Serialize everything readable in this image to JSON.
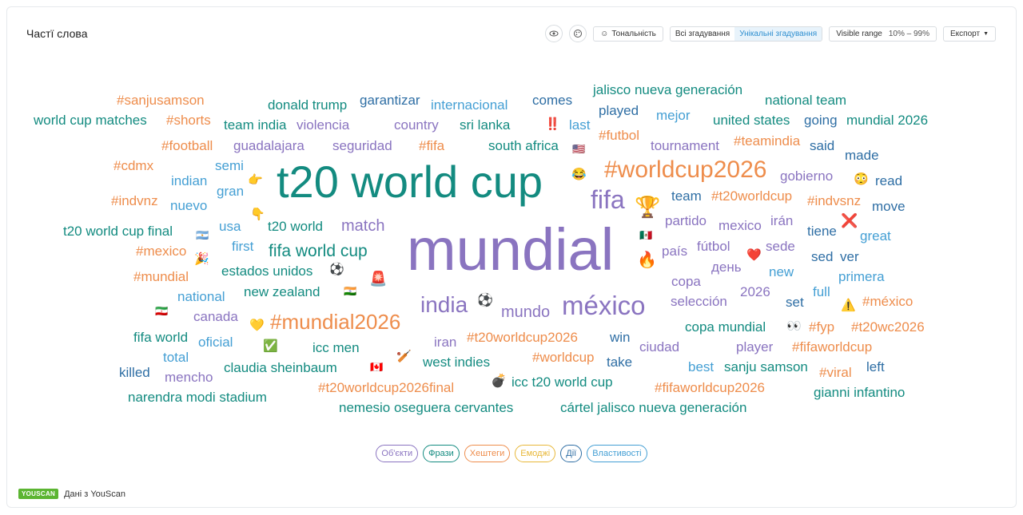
{
  "header": {
    "title": "Частї слова"
  },
  "toolbar": {
    "eye_icon": "eye-icon",
    "palette_icon": "palette-icon",
    "sentiment_label": "Тональність",
    "all_mentions": "Всі згадування",
    "unique_mentions": "Унікальні згадування",
    "visible_range_label": "Visible range",
    "visible_range_value": "10% – 99%",
    "export_label": "Експорт"
  },
  "colors": {
    "teal": "#138b80",
    "purple": "#8a74c0",
    "orange": "#ee8d4c",
    "blue": "#449fd4",
    "darkblue": "#2e6ea4",
    "green": "#1e8a55"
  },
  "cloud_words": [
    {
      "text": "#sanjusamson",
      "color": "#ee8d4c"
    },
    {
      "text": "donald trump",
      "color": "#138b80"
    },
    {
      "text": "garantizar",
      "color": "#2e6ea4"
    },
    {
      "text": "internacional",
      "color": "#449fd4"
    },
    {
      "text": "comes",
      "color": "#2e6ea4"
    },
    {
      "text": "jalisco nueva generación",
      "color": "#138b80"
    },
    {
      "text": "national team",
      "color": "#138b80"
    },
    {
      "text": "played",
      "color": "#2e6ea4"
    },
    {
      "text": "mejor",
      "color": "#449fd4"
    },
    {
      "text": "world cup matches",
      "color": "#138b80"
    },
    {
      "text": "#shorts",
      "color": "#ee8d4c"
    },
    {
      "text": "team india",
      "color": "#138b80"
    },
    {
      "text": "violencia",
      "color": "#8a74c0"
    },
    {
      "text": "country",
      "color": "#8a74c0"
    },
    {
      "text": "sri lanka",
      "color": "#138b80"
    },
    {
      "text": "last",
      "color": "#449fd4"
    },
    {
      "text": "united states",
      "color": "#138b80"
    },
    {
      "text": "going",
      "color": "#2e6ea4"
    },
    {
      "text": "mundial 2026",
      "color": "#138b80"
    },
    {
      "text": "#futbol",
      "color": "#ee8d4c"
    },
    {
      "text": "#football",
      "color": "#ee8d4c"
    },
    {
      "text": "guadalajara",
      "color": "#8a74c0"
    },
    {
      "text": "seguridad",
      "color": "#8a74c0"
    },
    {
      "text": "#fifa",
      "color": "#ee8d4c"
    },
    {
      "text": "south africa",
      "color": "#138b80"
    },
    {
      "text": "tournament",
      "color": "#8a74c0"
    },
    {
      "text": "#teamindia",
      "color": "#ee8d4c"
    },
    {
      "text": "said",
      "color": "#2e6ea4"
    },
    {
      "text": "made",
      "color": "#2e6ea4"
    },
    {
      "text": "#cdmx",
      "color": "#ee8d4c"
    },
    {
      "text": "semi",
      "color": "#449fd4"
    },
    {
      "text": "t20 world cup",
      "color": "#138b80"
    },
    {
      "text": "#worldcup2026",
      "color": "#ee8d4c"
    },
    {
      "text": "gobierno",
      "color": "#8a74c0"
    },
    {
      "text": "read",
      "color": "#2e6ea4"
    },
    {
      "text": "indian",
      "color": "#449fd4"
    },
    {
      "text": "gran",
      "color": "#449fd4"
    },
    {
      "text": "fifa",
      "color": "#8a74c0"
    },
    {
      "text": "team",
      "color": "#2e6ea4"
    },
    {
      "text": "#t20worldcup",
      "color": "#ee8d4c"
    },
    {
      "text": "#indvsnz",
      "color": "#ee8d4c"
    },
    {
      "text": "#indvnz",
      "color": "#ee8d4c"
    },
    {
      "text": "nuevo",
      "color": "#449fd4"
    },
    {
      "text": "move",
      "color": "#2e6ea4"
    },
    {
      "text": "partido",
      "color": "#8a74c0"
    },
    {
      "text": "mexico",
      "color": "#8a74c0"
    },
    {
      "text": "irán",
      "color": "#8a74c0"
    },
    {
      "text": "usa",
      "color": "#449fd4"
    },
    {
      "text": "t20 world",
      "color": "#138b80"
    },
    {
      "text": "match",
      "color": "#8a74c0"
    },
    {
      "text": "tiene",
      "color": "#2e6ea4"
    },
    {
      "text": "t20 world cup final",
      "color": "#138b80"
    },
    {
      "text": "great",
      "color": "#449fd4"
    },
    {
      "text": "first",
      "color": "#449fd4"
    },
    {
      "text": "mundial",
      "color": "#8a74c0"
    },
    {
      "text": "país",
      "color": "#8a74c0"
    },
    {
      "text": "fútbol",
      "color": "#8a74c0"
    },
    {
      "text": "sede",
      "color": "#8a74c0"
    },
    {
      "text": "#mexico",
      "color": "#ee8d4c"
    },
    {
      "text": "fifa world cup",
      "color": "#138b80"
    },
    {
      "text": "sed",
      "color": "#2e6ea4"
    },
    {
      "text": "ver",
      "color": "#2e6ea4"
    },
    {
      "text": "день",
      "color": "#8a74c0"
    },
    {
      "text": "estados unidos",
      "color": "#138b80"
    },
    {
      "text": "new",
      "color": "#449fd4"
    },
    {
      "text": "#mundial",
      "color": "#ee8d4c"
    },
    {
      "text": "copa",
      "color": "#8a74c0"
    },
    {
      "text": "primera",
      "color": "#449fd4"
    },
    {
      "text": "new zealand",
      "color": "#138b80"
    },
    {
      "text": "2026",
      "color": "#8a74c0"
    },
    {
      "text": "full",
      "color": "#449fd4"
    },
    {
      "text": "national",
      "color": "#449fd4"
    },
    {
      "text": "india",
      "color": "#8a74c0"
    },
    {
      "text": "méxico",
      "color": "#8a74c0"
    },
    {
      "text": "selección",
      "color": "#8a74c0"
    },
    {
      "text": "set",
      "color": "#2e6ea4"
    },
    {
      "text": "#méxico",
      "color": "#ee8d4c"
    },
    {
      "text": "mundo",
      "color": "#8a74c0"
    },
    {
      "text": "canada",
      "color": "#8a74c0"
    },
    {
      "text": "#mundial2026",
      "color": "#ee8d4c"
    },
    {
      "text": "copa mundial",
      "color": "#138b80"
    },
    {
      "text": "#fyp",
      "color": "#ee8d4c"
    },
    {
      "text": "#t20wc2026",
      "color": "#ee8d4c"
    },
    {
      "text": "fifa world",
      "color": "#138b80"
    },
    {
      "text": "oficial",
      "color": "#449fd4"
    },
    {
      "text": "#t20worldcup2026",
      "color": "#ee8d4c"
    },
    {
      "text": "win",
      "color": "#2e6ea4"
    },
    {
      "text": "iran",
      "color": "#8a74c0"
    },
    {
      "text": "ciudad",
      "color": "#8a74c0"
    },
    {
      "text": "player",
      "color": "#8a74c0"
    },
    {
      "text": "#fifaworldcup",
      "color": "#ee8d4c"
    },
    {
      "text": "total",
      "color": "#449fd4"
    },
    {
      "text": "icc men",
      "color": "#138b80"
    },
    {
      "text": "#worldcup",
      "color": "#ee8d4c"
    },
    {
      "text": "west indies",
      "color": "#138b80"
    },
    {
      "text": "take",
      "color": "#2e6ea4"
    },
    {
      "text": "best",
      "color": "#449fd4"
    },
    {
      "text": "sanju samson",
      "color": "#138b80"
    },
    {
      "text": "left",
      "color": "#2e6ea4"
    },
    {
      "text": "killed",
      "color": "#2e6ea4"
    },
    {
      "text": "mencho",
      "color": "#8a74c0"
    },
    {
      "text": "claudia sheinbaum",
      "color": "#138b80"
    },
    {
      "text": "#viral",
      "color": "#ee8d4c"
    },
    {
      "text": "icc t20 world cup",
      "color": "#138b80"
    },
    {
      "text": "narendra modi stadium",
      "color": "#138b80"
    },
    {
      "text": "#t20worldcup2026final",
      "color": "#ee8d4c"
    },
    {
      "text": "#fifaworldcup2026",
      "color": "#ee8d4c"
    },
    {
      "text": "gianni infantino",
      "color": "#138b80"
    },
    {
      "text": "nemesio oseguera cervantes",
      "color": "#138b80"
    },
    {
      "text": "cártel jalisco nueva generación",
      "color": "#138b80"
    }
  ],
  "cloud_emojis": [
    "‼️",
    "🇺🇸",
    "👉",
    "😂",
    "😳",
    "🏆",
    "👇",
    "❌",
    "🇦🇷",
    "🇲🇽",
    "🎉",
    "❤️",
    "⚽",
    "🔥",
    "🚨",
    "🇮🇳",
    "⚽",
    "🇮🇷",
    "⚠️",
    "💛",
    "👀",
    "✅",
    "🏏",
    "🇨🇦",
    "💣"
  ],
  "filters": [
    {
      "label": "Об'єкти",
      "color": "#8a74c0"
    },
    {
      "label": "Фрази",
      "color": "#138b80"
    },
    {
      "label": "Хештеги",
      "color": "#ee8d4c"
    },
    {
      "label": "Емоджі",
      "color": "#e8b83a"
    },
    {
      "label": "Дії",
      "color": "#2e6ea4"
    },
    {
      "label": "Властивості",
      "color": "#449fd4"
    }
  ],
  "footer": {
    "logo": "YOUSCAN",
    "text": "Дані з YouScan"
  }
}
